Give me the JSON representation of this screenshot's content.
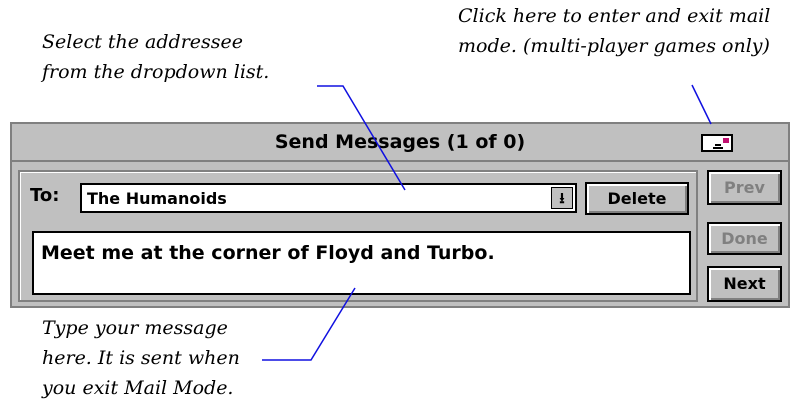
{
  "callouts": {
    "addressee_line1": "Select the addressee",
    "addressee_line2": "from the dropdown list.",
    "mail_line1": "Click here to enter and exit mail",
    "mail_line2": "mode. (multi-player games only)",
    "message_line1": "Type your message",
    "message_line2": "here. It is sent when",
    "message_line3": "you exit Mail Mode."
  },
  "dialog": {
    "title": "Send Messages (1 of 0)",
    "mail_icon": "envelope-icon",
    "to_label": "To:",
    "to_value": "The Humanoids",
    "dropdown_glyph": "⭳",
    "delete_label": "Delete",
    "message_text": "Meet me at the corner of Floyd and Turbo.",
    "prev_label": "Prev",
    "done_label": "Done",
    "next_label": "Next"
  },
  "colors": {
    "panel_bg": "#c0c0c0",
    "disabled_text": "#808080",
    "leader_line": "#1010e0",
    "stamp": "#c01070"
  }
}
